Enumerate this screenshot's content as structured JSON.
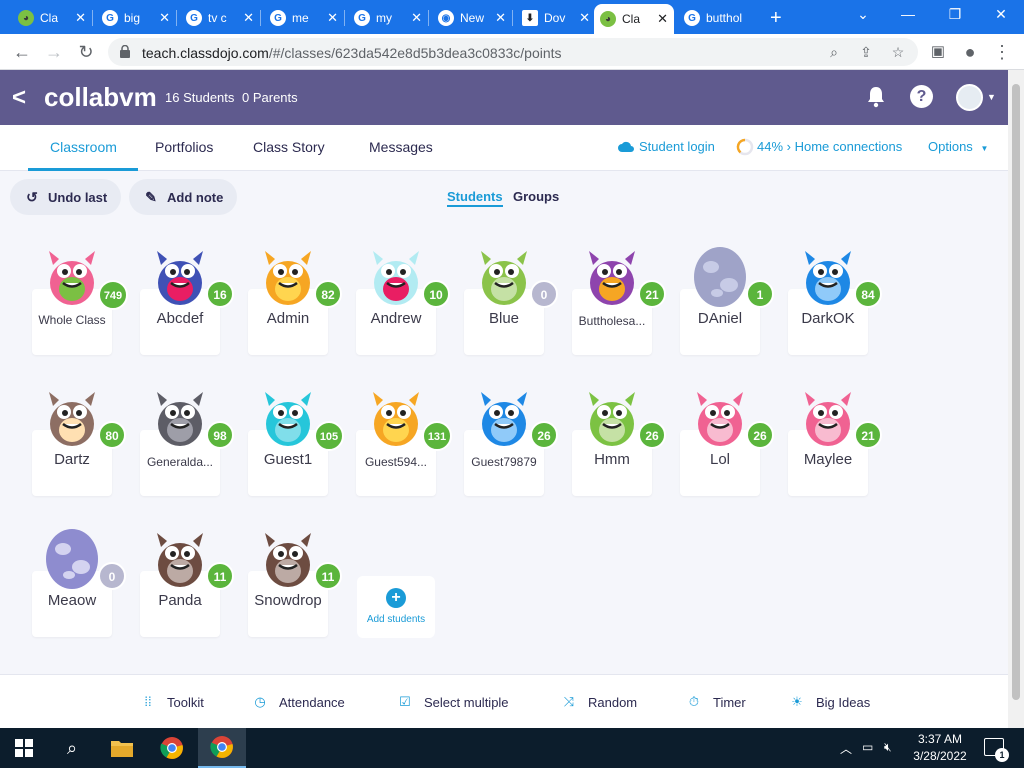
{
  "browser": {
    "tabs": [
      {
        "label": "Cla",
        "favicon": "classdojo-icon",
        "active": false
      },
      {
        "label": "big",
        "favicon": "google-icon",
        "active": false
      },
      {
        "label": "tv c",
        "favicon": "google-icon",
        "active": false
      },
      {
        "label": "me",
        "favicon": "google-icon",
        "active": false
      },
      {
        "label": "my",
        "favicon": "google-icon",
        "active": false
      },
      {
        "label": "New",
        "favicon": "chrome-icon",
        "active": false
      },
      {
        "label": "Dov",
        "favicon": "download-icon",
        "active": false
      },
      {
        "label": "Cla",
        "favicon": "classdojo-icon",
        "active": true
      },
      {
        "label": "butthol",
        "favicon": "google-icon",
        "active": false
      }
    ],
    "new_tab_symbol": "+",
    "url_host": "teach.classdojo.com",
    "url_path": "/#/classes/623da542e8d5b3dea3c0833c/points",
    "tab_strip_color": "#1a73e8"
  },
  "classbar": {
    "back_symbol": "<",
    "class_name": "collabvm",
    "students": "16 Students",
    "parents": "0 Parents",
    "help_symbol": "?",
    "bg_color": "#5f5a8e"
  },
  "navtabs": {
    "classroom": "Classroom",
    "portfolios": "Portfolios",
    "class_story": "Class Story",
    "messages": "Messages",
    "student_login": "Student login",
    "home_connections": "44% › Home connections",
    "options": "Options",
    "accent_color": "#1a9bd7"
  },
  "actions": {
    "undo": "Undo last",
    "add_note": "Add note",
    "students_toggle": "Students",
    "groups_toggle": "Groups"
  },
  "students": [
    {
      "name": "Whole Class",
      "points": "749",
      "avatar": "group-monsters-icon"
    },
    {
      "name": "Abcdef",
      "points": "16",
      "avatar": "party-monster-icon"
    },
    {
      "name": "Admin",
      "points": "82",
      "avatar": "orange-monster-icon"
    },
    {
      "name": "Andrew",
      "points": "10",
      "avatar": "hearts-monster-icon"
    },
    {
      "name": "Blue",
      "points": "0",
      "avatar": "green-monster-icon"
    },
    {
      "name": "Buttholesa...",
      "points": "21",
      "avatar": "purple-monster-icon"
    },
    {
      "name": "DAniel",
      "points": "1",
      "avatar": "egg-icon"
    },
    {
      "name": "DarkOK",
      "points": "84",
      "avatar": "blue-monster-icon"
    },
    {
      "name": "Dartz",
      "points": "80",
      "avatar": "hamster-monster-icon"
    },
    {
      "name": "Generalda...",
      "points": "98",
      "avatar": "gray-monster-icon"
    },
    {
      "name": "Guest1",
      "points": "105",
      "avatar": "cyan-monster-icon"
    },
    {
      "name": "Guest594...",
      "points": "131",
      "avatar": "orange-monster-icon"
    },
    {
      "name": "Guest79879",
      "points": "26",
      "avatar": "blue-monster-icon"
    },
    {
      "name": "Hmm",
      "points": "26",
      "avatar": "cyclops-monster-icon"
    },
    {
      "name": "Lol",
      "points": "26",
      "avatar": "pink-monster-icon"
    },
    {
      "name": "Maylee",
      "points": "21",
      "avatar": "pink-monster-icon"
    },
    {
      "name": "Meaow",
      "points": "0",
      "avatar": "striped-egg-icon"
    },
    {
      "name": "Panda",
      "points": "11",
      "avatar": "brown-cyclops-icon"
    },
    {
      "name": "Snowdrop",
      "points": "11",
      "avatar": "brown-cyclops-icon"
    }
  ],
  "add_students": {
    "label": "Add students",
    "symbol": "+"
  },
  "tools": {
    "toolkit": "Toolkit",
    "attendance": "Attendance",
    "select_multiple": "Select multiple",
    "random": "Random",
    "timer": "Timer",
    "big_ideas": "Big Ideas"
  },
  "taskbar": {
    "time": "3:37 AM",
    "date": "3/28/2022",
    "notifications": "1"
  },
  "colors": {
    "points_green": "#5bb53c",
    "points_zero": "#b7b7cf"
  }
}
